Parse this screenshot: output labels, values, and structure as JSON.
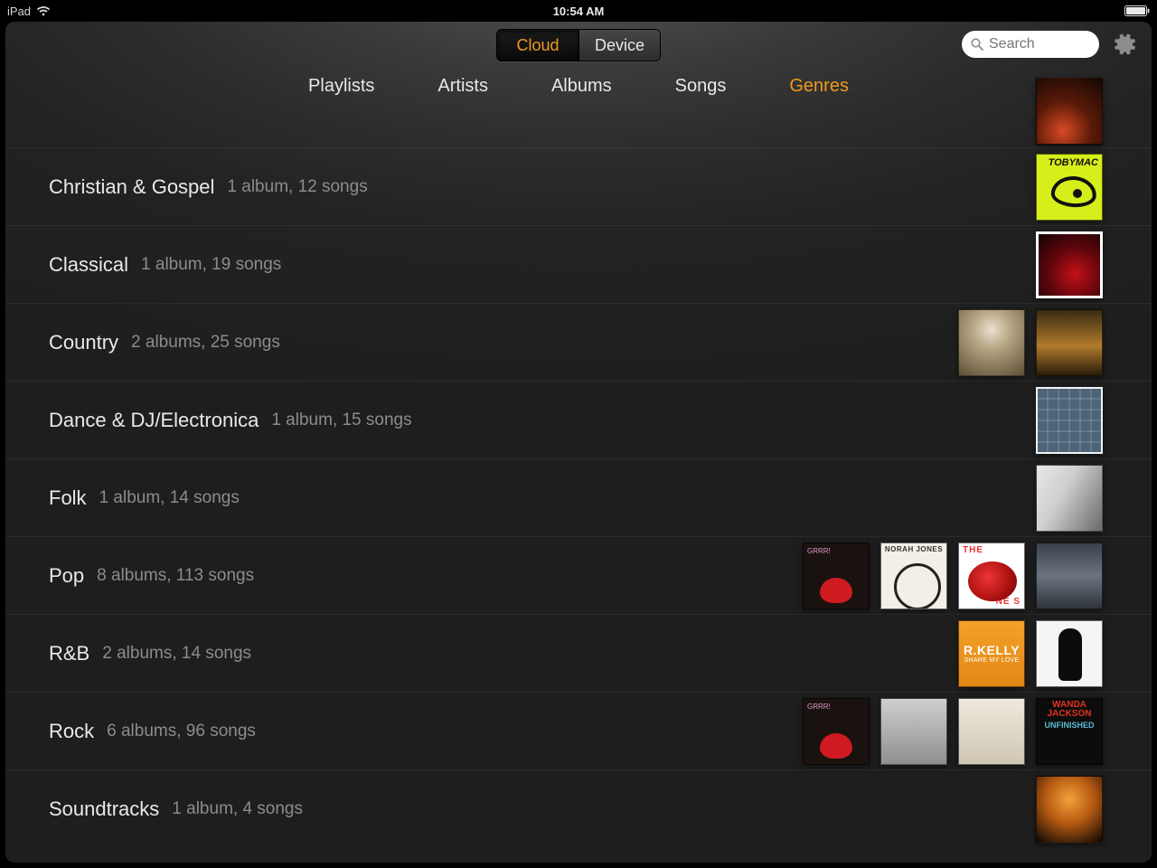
{
  "status": {
    "carrier": "iPad",
    "time": "10:54 AM"
  },
  "header": {
    "seg_cloud": "Cloud",
    "seg_device": "Device",
    "search_placeholder": "Search"
  },
  "tabs": {
    "playlists": "Playlists",
    "artists": "Artists",
    "albums": "Albums",
    "songs": "Songs",
    "genres": "Genres"
  },
  "genres": [
    {
      "name": "Christian & Gospel",
      "meta": "1 album, 12 songs",
      "art": [
        "tobymac"
      ]
    },
    {
      "name": "Classical",
      "meta": "1 album, 19 songs",
      "art": [
        "red"
      ]
    },
    {
      "name": "Country",
      "meta": "2 albums, 25 songs",
      "art": [
        "skull",
        "gold"
      ]
    },
    {
      "name": "Dance & DJ/Electronica",
      "meta": "1 album, 15 songs",
      "art": [
        "grid"
      ]
    },
    {
      "name": "Folk",
      "meta": "1 album, 14 songs",
      "art": [
        "photo"
      ]
    },
    {
      "name": "Pop",
      "meta": "8 albums, 113 songs",
      "art": [
        "grrr",
        "norah",
        "sub",
        "train"
      ]
    },
    {
      "name": "R&B",
      "meta": "2 albums, 14 songs",
      "art": [
        "rkelly",
        "alicia"
      ]
    },
    {
      "name": "Rock",
      "meta": "6 albums, 96 songs",
      "art": [
        "grrr",
        "grey",
        "sg",
        "wanda"
      ]
    },
    {
      "name": "Soundtracks",
      "meta": "1 album, 4 songs",
      "art": [
        "hunger"
      ]
    }
  ],
  "art_labels": {
    "tobymac": "TOBYMAC",
    "norah": "NORAH JONES",
    "sub_top": "THE",
    "sub_bot": "NE S",
    "rkelly_main": "R.KELLY",
    "rkelly_sub": "SHARE MY LOVE",
    "wanda_top": "WANDA JACKSON",
    "wanda_mid": "UNFINISHED",
    "grrr": "GRRR!"
  }
}
